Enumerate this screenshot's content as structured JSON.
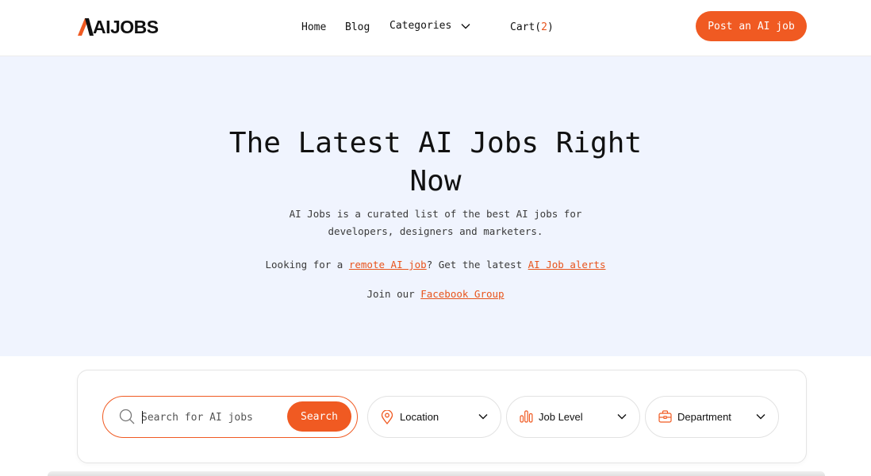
{
  "header": {
    "logo_text": "AIJOBS",
    "nav": {
      "home": "Home",
      "blog": "Blog",
      "categories": "Categories",
      "cart_label": "Cart(",
      "cart_count": "2",
      "cart_close": ")"
    },
    "post_button": "Post an AI job"
  },
  "hero": {
    "title": "The Latest AI Jobs Right Now",
    "subtitle": "AI Jobs is a curated list of the best AI jobs for developers, designers and marketers.",
    "line1": {
      "prefix": "Looking for a ",
      "remote_link": "remote AI job",
      "middle": "? Get the latest ",
      "alerts_link": "AI Job alerts"
    },
    "line2": {
      "prefix": "Join our ",
      "facebook_link": "Facebook Group"
    }
  },
  "search": {
    "placeholder": "Search for AI jobs",
    "button": "Search",
    "filters": {
      "location": "Location",
      "job_level": "Job Level",
      "department": "Department"
    }
  },
  "colors": {
    "accent": "#f05a22",
    "hero_bg": "#f0f4fe"
  },
  "icons": [
    "logo-mark-icon",
    "chevron-down-icon",
    "search-icon",
    "location-pin-icon",
    "bar-chart-icon",
    "briefcase-icon"
  ]
}
